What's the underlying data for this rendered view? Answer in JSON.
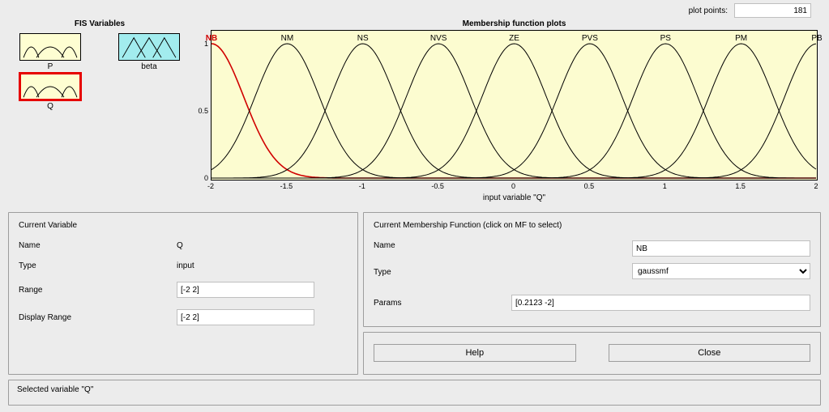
{
  "plot_points": {
    "label": "plot points:",
    "value": "181"
  },
  "fis": {
    "title": "FIS Variables",
    "vars": [
      {
        "name": "P",
        "kind": "input",
        "selected": false
      },
      {
        "name": "beta",
        "kind": "output",
        "selected": false
      },
      {
        "name": "Q",
        "kind": "input",
        "selected": true
      }
    ]
  },
  "chart_data": {
    "type": "line",
    "title": "Membership function plots",
    "xlabel": "input variable \"Q\"",
    "ylabel": "",
    "xlim": [
      -2,
      2
    ],
    "ylim": [
      0,
      1
    ],
    "xticks": [
      -2,
      -1.5,
      -1,
      -0.5,
      0,
      0.5,
      1,
      1.5,
      2
    ],
    "yticks": [
      0,
      0.5,
      1
    ],
    "mf_type": "gaussmf",
    "sigma": 0.2123,
    "series": [
      {
        "name": "NB",
        "mean": -2.0,
        "selected": true
      },
      {
        "name": "NM",
        "mean": -1.5,
        "selected": false
      },
      {
        "name": "NS",
        "mean": -1.0,
        "selected": false
      },
      {
        "name": "NVS",
        "mean": -0.5,
        "selected": false
      },
      {
        "name": "ZE",
        "mean": 0.0,
        "selected": false
      },
      {
        "name": "PVS",
        "mean": 0.5,
        "selected": false
      },
      {
        "name": "PS",
        "mean": 1.0,
        "selected": false
      },
      {
        "name": "PM",
        "mean": 1.5,
        "selected": false
      },
      {
        "name": "PB",
        "mean": 2.0,
        "selected": false
      }
    ]
  },
  "current_variable": {
    "panel_title": "Current Variable",
    "name_label": "Name",
    "name_value": "Q",
    "type_label": "Type",
    "type_value": "input",
    "range_label": "Range",
    "range_value": "[-2 2]",
    "disp_label": "Display Range",
    "disp_value": "[-2 2]"
  },
  "current_mf": {
    "panel_title": "Current Membership Function (click on MF to select)",
    "name_label": "Name",
    "name_value": "NB",
    "type_label": "Type",
    "type_value": "gaussmf",
    "params_label": "Params",
    "params_value": "[0.2123 -2]"
  },
  "buttons": {
    "help": "Help",
    "close": "Close"
  },
  "status": "Selected variable \"Q\""
}
